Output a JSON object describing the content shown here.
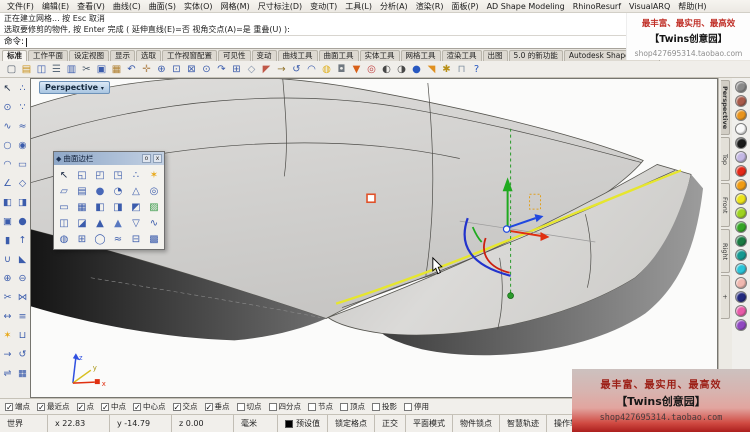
{
  "menu_bar": {
    "items": [
      "文件(F)",
      "编辑(E)",
      "查看(V)",
      "曲线(C)",
      "曲面(S)",
      "实体(O)",
      "网格(M)",
      "尺寸标注(D)",
      "变动(T)",
      "工具(L)",
      "分析(A)",
      "渲染(R)",
      "面板(P)",
      "AD Shape Modeling",
      "RhinoResurf",
      "VisualARQ",
      "帮助(H)"
    ]
  },
  "command": {
    "history_line1": "正在建立网格... 按 Esc 取消",
    "history_line2": "选取要修剪的物件, 按 Enter 完成 ( 延伸直线(E)=否  视角交点(A)=是  重叠(U) ):",
    "prompt_label": "命令:"
  },
  "watermark_top": {
    "line1": "最丰富、最实用、最高效",
    "line2": "【Twins创意园】",
    "line3": "shop427695314.taobao.com"
  },
  "watermark_bottom": {
    "line1": "最丰富、最实用、最高效",
    "line2": "【Twins创意园】",
    "line3": "shop427695314.taobao.com"
  },
  "toolbar_tabs": {
    "items": [
      {
        "label": "标准",
        "active": true
      },
      {
        "label": "工作平面"
      },
      {
        "label": "设定视图"
      },
      {
        "label": "显示"
      },
      {
        "label": "选取"
      },
      {
        "label": "工作视窗配置"
      },
      {
        "label": "可见性"
      },
      {
        "label": "变动"
      },
      {
        "label": "曲线工具"
      },
      {
        "label": "曲面工具"
      },
      {
        "label": "实体工具"
      },
      {
        "label": "网格工具"
      },
      {
        "label": "渲染工具"
      },
      {
        "label": "出图"
      },
      {
        "label": "5.0 的新功能"
      },
      {
        "label": "Autodesk Shape Model"
      }
    ]
  },
  "main_toolbar": {
    "icons": [
      {
        "name": "new-file-icon",
        "glyph": "▢",
        "color": "#55606e"
      },
      {
        "name": "open-file-icon",
        "glyph": "▤",
        "color": "#c89018"
      },
      {
        "name": "save-icon",
        "glyph": "◫",
        "color": "#3b5cac"
      },
      {
        "name": "print-icon",
        "glyph": "☰",
        "color": "#5a6a7a"
      },
      {
        "name": "copy-to-clipboard-icon",
        "glyph": "▥",
        "color": "#3b5cac"
      },
      {
        "name": "cut-icon",
        "glyph": "✂",
        "color": "#4a5a6a"
      },
      {
        "name": "copy-icon",
        "glyph": "▣",
        "color": "#3b5cac"
      },
      {
        "name": "paste-icon",
        "glyph": "▦",
        "color": "#b08030"
      },
      {
        "name": "undo-icon",
        "glyph": "↶",
        "color": "#3b5cac"
      },
      {
        "name": "pan-icon",
        "glyph": "✛",
        "color": "#b89060"
      },
      {
        "name": "zoom-dynamic-icon",
        "glyph": "⊕",
        "color": "#3b5cac"
      },
      {
        "name": "zoom-window-icon",
        "glyph": "⊡",
        "color": "#3b5cac"
      },
      {
        "name": "zoom-extents-icon",
        "glyph": "⊠",
        "color": "#3b5cac"
      },
      {
        "name": "zoom-selected-icon",
        "glyph": "⊙",
        "color": "#3b5cac"
      },
      {
        "name": "redo-view-icon",
        "glyph": "↷",
        "color": "#3b5cac"
      },
      {
        "name": "viewport-layout-icon",
        "glyph": "⊞",
        "color": "#3b5cac"
      },
      {
        "name": "object-snap-icon",
        "glyph": "◇",
        "color": "#8090a8"
      },
      {
        "name": "erase-icon",
        "glyph": "◤",
        "color": "#c05848"
      },
      {
        "name": "move-icon",
        "glyph": "→",
        "color": "#90722a"
      },
      {
        "name": "rotate-view-icon",
        "glyph": "↺",
        "color": "#3b5cac"
      },
      {
        "name": "set-cplane-icon",
        "glyph": "◠",
        "color": "#3b5cac"
      },
      {
        "name": "display-bulb-icon",
        "glyph": "◍",
        "color": "#e0b020"
      },
      {
        "name": "lock-icon",
        "glyph": "◘",
        "color": "#707880"
      },
      {
        "name": "render-icon",
        "glyph": "▼",
        "color": "#d86018"
      },
      {
        "name": "color-wheel-icon",
        "glyph": "◎",
        "color": "#c04040"
      },
      {
        "name": "render-preview-icon",
        "glyph": "◐",
        "color": "#484848"
      },
      {
        "name": "shaded-viewport-icon",
        "glyph": "◑",
        "color": "#484848"
      },
      {
        "name": "earth-globe-icon",
        "glyph": "●",
        "color": "#2858c0"
      },
      {
        "name": "notify-flag-icon",
        "glyph": "◥",
        "color": "#e09020"
      },
      {
        "name": "options-gear-icon",
        "glyph": "✱",
        "color": "#b89018"
      },
      {
        "name": "link-surface-icon",
        "glyph": "⊓",
        "color": "#8090a0"
      },
      {
        "name": "help-icon",
        "glyph": "?",
        "color": "#2858c0"
      }
    ]
  },
  "left_toolbar": {
    "icons": [
      {
        "name": "select-icon",
        "glyph": "↖",
        "color": "#20304a"
      },
      {
        "name": "control-points-icon",
        "glyph": "∴",
        "color": "#3b5cac"
      },
      {
        "name": "point-icon",
        "glyph": "⊙",
        "color": "#3b5cac"
      },
      {
        "name": "point-cloud-icon",
        "glyph": "∵",
        "color": "#3b5cac"
      },
      {
        "name": "curve-icon",
        "glyph": "∿",
        "color": "#3b5cac"
      },
      {
        "name": "interpolate-curve-icon",
        "glyph": "≈",
        "color": "#3b5cac"
      },
      {
        "name": "circle-icon",
        "glyph": "○",
        "color": "#3b5cac"
      },
      {
        "name": "ellipse-icon",
        "glyph": "◉",
        "color": "#3b5cac"
      },
      {
        "name": "arc-icon",
        "glyph": "◠",
        "color": "#3b5cac"
      },
      {
        "name": "rectangle-icon",
        "glyph": "▭",
        "color": "#3b5cac"
      },
      {
        "name": "polyline-icon",
        "glyph": "∠",
        "color": "#3b5cac"
      },
      {
        "name": "polygon-icon",
        "glyph": "◇",
        "color": "#3b5cac"
      },
      {
        "name": "surface-corner-icon",
        "glyph": "◧",
        "color": "#3b5cac"
      },
      {
        "name": "loft-icon",
        "glyph": "◨",
        "color": "#3b5cac"
      },
      {
        "name": "box-icon",
        "glyph": "▣",
        "color": "#3b5cac"
      },
      {
        "name": "sphere-icon",
        "glyph": "●",
        "color": "#3b5cac"
      },
      {
        "name": "cylinder-icon",
        "glyph": "▮",
        "color": "#3b5cac"
      },
      {
        "name": "extrude-icon",
        "glyph": "↑",
        "color": "#3b5cac"
      },
      {
        "name": "fillet-icon",
        "glyph": "∪",
        "color": "#3b5cac"
      },
      {
        "name": "chamfer-icon",
        "glyph": "◣",
        "color": "#3b5cac"
      },
      {
        "name": "boolean-union-icon",
        "glyph": "⊕",
        "color": "#3b5cac"
      },
      {
        "name": "boolean-difference-icon",
        "glyph": "⊖",
        "color": "#3b5cac"
      },
      {
        "name": "trim-icon",
        "glyph": "✂",
        "color": "#3b5cac"
      },
      {
        "name": "split-icon",
        "glyph": "⋈",
        "color": "#3b5cac"
      },
      {
        "name": "extend-icon",
        "glyph": "↔",
        "color": "#3b5cac"
      },
      {
        "name": "offset-icon",
        "glyph": "≡",
        "color": "#3b5cac"
      },
      {
        "name": "explode-icon",
        "glyph": "✶",
        "color": "#e8a818"
      },
      {
        "name": "join-icon",
        "glyph": "⊔",
        "color": "#3b5cac"
      },
      {
        "name": "move-icon",
        "glyph": "→",
        "color": "#3b5cac"
      },
      {
        "name": "rotate-icon",
        "glyph": "↺",
        "color": "#3b5cac"
      },
      {
        "name": "mirror-icon",
        "glyph": "⇌",
        "color": "#3b5cac"
      },
      {
        "name": "array-icon",
        "glyph": "▦",
        "color": "#3b5cac"
      }
    ]
  },
  "surface_panel": {
    "title": "曲面边栏",
    "minimize_label": "o",
    "close_label": "x",
    "icons": [
      {
        "name": "select-icon",
        "glyph": "↖",
        "color": "#20304a"
      },
      {
        "name": "surface-2pt-icon",
        "glyph": "◱",
        "color": "#3b5cac"
      },
      {
        "name": "surface-3pt-icon",
        "glyph": "◰",
        "color": "#3b5cac"
      },
      {
        "name": "surface-corner-points-icon",
        "glyph": "◳",
        "color": "#3b5cac"
      },
      {
        "name": "surface-from-points-icon",
        "glyph": "∴",
        "color": "#3b5cac"
      },
      {
        "name": "unroll-surface-icon",
        "glyph": "✶",
        "color": "#e8a818"
      },
      {
        "name": "plane-icon",
        "glyph": "▱",
        "color": "#3b5cac"
      },
      {
        "name": "picture-frame-icon",
        "glyph": "▤",
        "color": "#3b5cac"
      },
      {
        "name": "sphere-surface-icon",
        "glyph": "●",
        "color": "#4868b8"
      },
      {
        "name": "ellipsoid-icon",
        "glyph": "◔",
        "color": "#3b5cac"
      },
      {
        "name": "cone-icon",
        "glyph": "△",
        "color": "#3b5cac"
      },
      {
        "name": "torus-icon",
        "glyph": "◎",
        "color": "#3b5cac"
      },
      {
        "name": "rect-plane-icon",
        "glyph": "▭",
        "color": "#3b5cac"
      },
      {
        "name": "deformable-plane-icon",
        "glyph": "▦",
        "color": "#3b5cac"
      },
      {
        "name": "extrude-straight-icon",
        "glyph": "◧",
        "color": "#3b5cac"
      },
      {
        "name": "extrude-along-curve-icon",
        "glyph": "◨",
        "color": "#3b5cac"
      },
      {
        "name": "extrude-tapered-icon",
        "glyph": "◩",
        "color": "#3b5cac"
      },
      {
        "name": "heightfield-icon",
        "glyph": "▨",
        "color": "#3a9a4a"
      },
      {
        "name": "loft-icon",
        "glyph": "◫",
        "color": "#3b5cac"
      },
      {
        "name": "sweep-1-rail-icon",
        "glyph": "◪",
        "color": "#3b5cac"
      },
      {
        "name": "sweep-2-rails-icon",
        "glyph": "▲",
        "color": "#3b5cac"
      },
      {
        "name": "revolve-icon",
        "glyph": "▲",
        "color": "#5878c0"
      },
      {
        "name": "rail-revolve-icon",
        "glyph": "▽",
        "color": "#3b5cac"
      },
      {
        "name": "blend-surface-icon",
        "glyph": "∿",
        "color": "#3b5cac"
      },
      {
        "name": "patch-icon",
        "glyph": "◍",
        "color": "#3b5cac"
      },
      {
        "name": "network-surface-icon",
        "glyph": "⊞",
        "color": "#3b5cac"
      },
      {
        "name": "pipe-icon",
        "glyph": "◯",
        "color": "#3b5cac"
      },
      {
        "name": "tween-surface-icon",
        "glyph": "≈",
        "color": "#3b5cac"
      },
      {
        "name": "offset-surface-icon",
        "glyph": "⊟",
        "color": "#3b5cac"
      },
      {
        "name": "point-grid-icon",
        "glyph": "▩",
        "color": "#3b5cac"
      }
    ]
  },
  "viewport": {
    "label": "Perspective",
    "dropdown_glyph": "▾"
  },
  "scene": {
    "selected_edge_color": "#e6e62e",
    "gumball_x_color": "#e03010",
    "gumball_y_color": "#2048e0",
    "gumball_z_color": "#1faa1f",
    "axis_labels": {
      "x": "x",
      "y": "y",
      "z": "z"
    }
  },
  "right_tabs": {
    "items": [
      {
        "label": "Perspective",
        "active": true
      },
      {
        "label": "Top"
      },
      {
        "label": "Front"
      },
      {
        "label": "Right"
      },
      {
        "label": "+",
        "small": true
      }
    ]
  },
  "color_palette": [
    "#8a8a8a",
    "#a85a4a",
    "#e8941e",
    "#f8f8f8",
    "#1a1a1a",
    "#c4b8e4",
    "#e42818",
    "#f09c14",
    "#ece318",
    "#9ed320",
    "#35a426",
    "#1a7a42",
    "#169890",
    "#2ac4d8",
    "#f0b8b0",
    "#23297e",
    "#e85aa8",
    "#9048c0"
  ],
  "osnap_bar": {
    "items": [
      {
        "label": "端点",
        "checked": true
      },
      {
        "label": "最近点",
        "checked": true
      },
      {
        "label": "点",
        "checked": true
      },
      {
        "label": "中点",
        "checked": true
      },
      {
        "label": "中心点",
        "checked": true
      },
      {
        "label": "交点",
        "checked": true
      },
      {
        "label": "垂点",
        "checked": true
      },
      {
        "label": "切点",
        "checked": false
      },
      {
        "label": "四分点",
        "checked": false
      },
      {
        "label": "节点",
        "checked": false
      },
      {
        "label": "顶点",
        "checked": false
      },
      {
        "label": "投影",
        "checked": false
      },
      {
        "label": "停用",
        "checked": false
      }
    ]
  },
  "status_bar": {
    "cplane": "世界",
    "coord_x": "x 22.83",
    "coord_y": "y -14.79",
    "coord_z": "z 0.00",
    "units": "毫米",
    "layer_name": "预设值",
    "layer_color": "#000000",
    "toggles": [
      "锁定格点",
      "正交",
      "平面模式",
      "物件锁点",
      "智慧轨迹",
      "操作轴"
    ]
  }
}
